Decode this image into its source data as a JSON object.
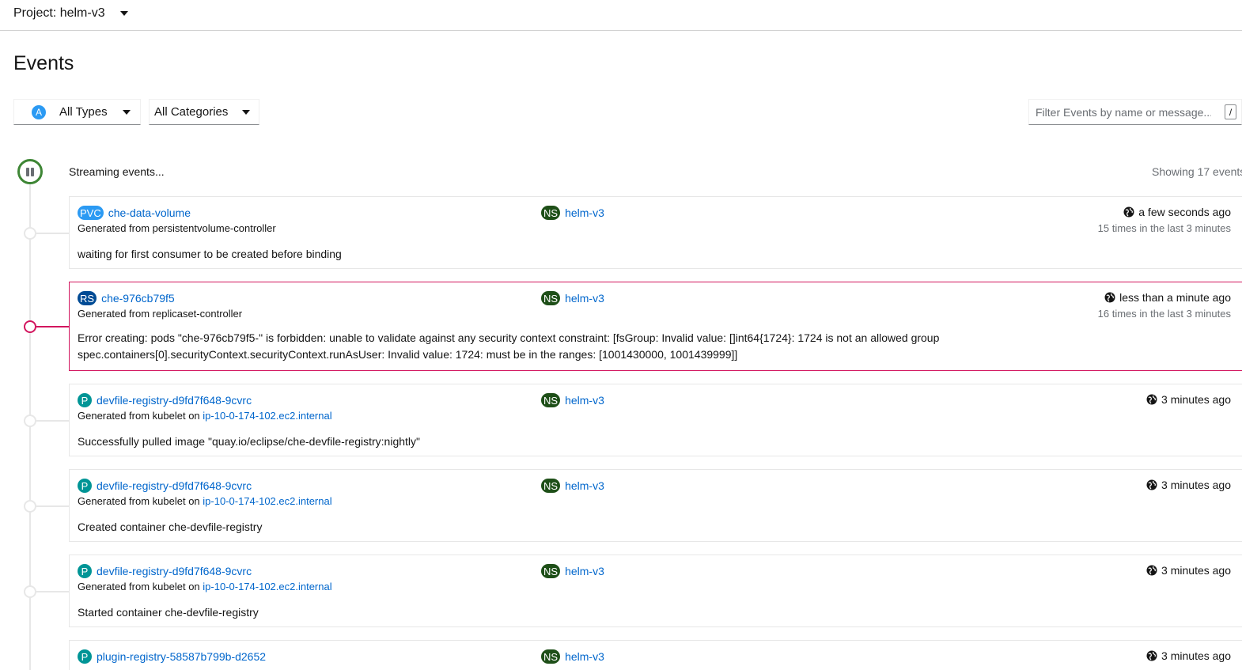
{
  "header": {
    "project_label": "Project: helm-v3"
  },
  "page_title": "Events",
  "filters": {
    "types_avatar": "A",
    "types_label": "All Types",
    "categories_label": "All Categories",
    "search_placeholder": "Filter Events by name or message...",
    "search_shortcut": "/"
  },
  "stream": {
    "status": "Streaming events...",
    "showing": "Showing 17 events"
  },
  "events": [
    {
      "kind_badge": "PVC",
      "name": "che-data-volume",
      "ns_badge": "NS",
      "namespace": "helm-v3",
      "generated_prefix": "Generated from persistentvolume-controller",
      "node_link": "",
      "message": "waiting for first consumer to be created before binding",
      "time": "a few seconds ago",
      "count": "15 times in the last 3 minutes",
      "error": false
    },
    {
      "kind_badge": "RS",
      "name": "che-976cb79f5",
      "ns_badge": "NS",
      "namespace": "helm-v3",
      "generated_prefix": "Generated from replicaset-controller",
      "node_link": "",
      "message": "Error creating: pods \"che-976cb79f5-\" is forbidden: unable to validate against any security context constraint: [fsGroup: Invalid value: []int64{1724}: 1724 is not an allowed group spec.containers[0].securityContext.securityContext.runAsUser: Invalid value: 1724: must be in the ranges: [1001430000, 1001439999]]",
      "time": "less than a minute ago",
      "count": "16 times in the last 3 minutes",
      "error": true
    },
    {
      "kind_badge": "P",
      "name": "devfile-registry-d9fd7f648-9cvrc",
      "ns_badge": "NS",
      "namespace": "helm-v3",
      "generated_prefix": "Generated from kubelet on",
      "node_link": "ip-10-0-174-102.ec2.internal",
      "message": "Successfully pulled image \"quay.io/eclipse/che-devfile-registry:nightly\"",
      "time": "3 minutes ago",
      "count": "",
      "error": false
    },
    {
      "kind_badge": "P",
      "name": "devfile-registry-d9fd7f648-9cvrc",
      "ns_badge": "NS",
      "namespace": "helm-v3",
      "generated_prefix": "Generated from kubelet on",
      "node_link": "ip-10-0-174-102.ec2.internal",
      "message": "Created container che-devfile-registry",
      "time": "3 minutes ago",
      "count": "",
      "error": false
    },
    {
      "kind_badge": "P",
      "name": "devfile-registry-d9fd7f648-9cvrc",
      "ns_badge": "NS",
      "namespace": "helm-v3",
      "generated_prefix": "Generated from kubelet on",
      "node_link": "ip-10-0-174-102.ec2.internal",
      "message": "Started container che-devfile-registry",
      "time": "3 minutes ago",
      "count": "",
      "error": false
    },
    {
      "kind_badge": "P",
      "name": "plugin-registry-58587b799b-d2652",
      "ns_badge": "NS",
      "namespace": "helm-v3",
      "generated_prefix": "",
      "node_link": "",
      "message": "",
      "time": "3 minutes ago",
      "count": "",
      "error": false
    }
  ]
}
